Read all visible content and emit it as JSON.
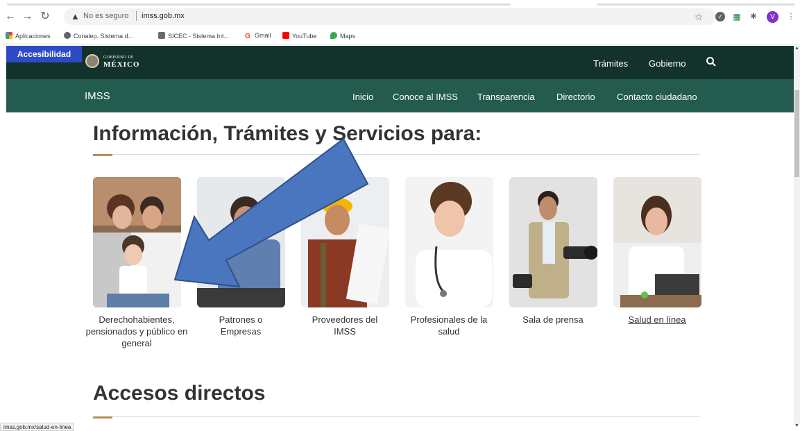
{
  "browser": {
    "url_warning": "No es seguro",
    "url_host": "imss.gob.mx",
    "bookmarks": [
      "Aplicaciones",
      "Conalep. Sistema d...",
      "SICEC - Sistema Int...",
      "Gmail",
      "YouTube",
      "Maps"
    ],
    "profile_initial": "V",
    "status_url": "imss.gob.mx/salud-en-linea"
  },
  "header": {
    "accessibility": "Accesibilidad",
    "gov_logo_small": "GOBIERNO DE",
    "gov_logo_big": "MÉXICO",
    "top_nav": [
      "Trámites",
      "Gobierno"
    ],
    "brand": "IMSS",
    "sub_nav": [
      "Inicio",
      "Conoce al IMSS",
      "Transparencia",
      "Directorio",
      "Contacto ciudadano"
    ]
  },
  "main": {
    "section_title": "Información, Trámites y Servicios para:",
    "cards": [
      {
        "label": "Derechohabientes, pensionados y público en general"
      },
      {
        "label": "Patrones o Empresas"
      },
      {
        "label": "Proveedores del IMSS"
      },
      {
        "label": "Profesionales de la salud"
      },
      {
        "label": "Sala de prensa"
      },
      {
        "label": "Salud en línea"
      }
    ],
    "accesos_title": "Accesos directos"
  },
  "colors": {
    "gov_dark": "#12322b",
    "gov_green": "#235b4e",
    "accent_gold": "#b38e5d",
    "accessibility_blue": "#2d4bc4",
    "annotation_arrow": "#4a76bf"
  },
  "icons": [
    "back-icon",
    "forward-icon",
    "reload-icon",
    "warning-icon",
    "star-icon",
    "search-icon",
    "apps-icon",
    "puzzle-icon"
  ]
}
